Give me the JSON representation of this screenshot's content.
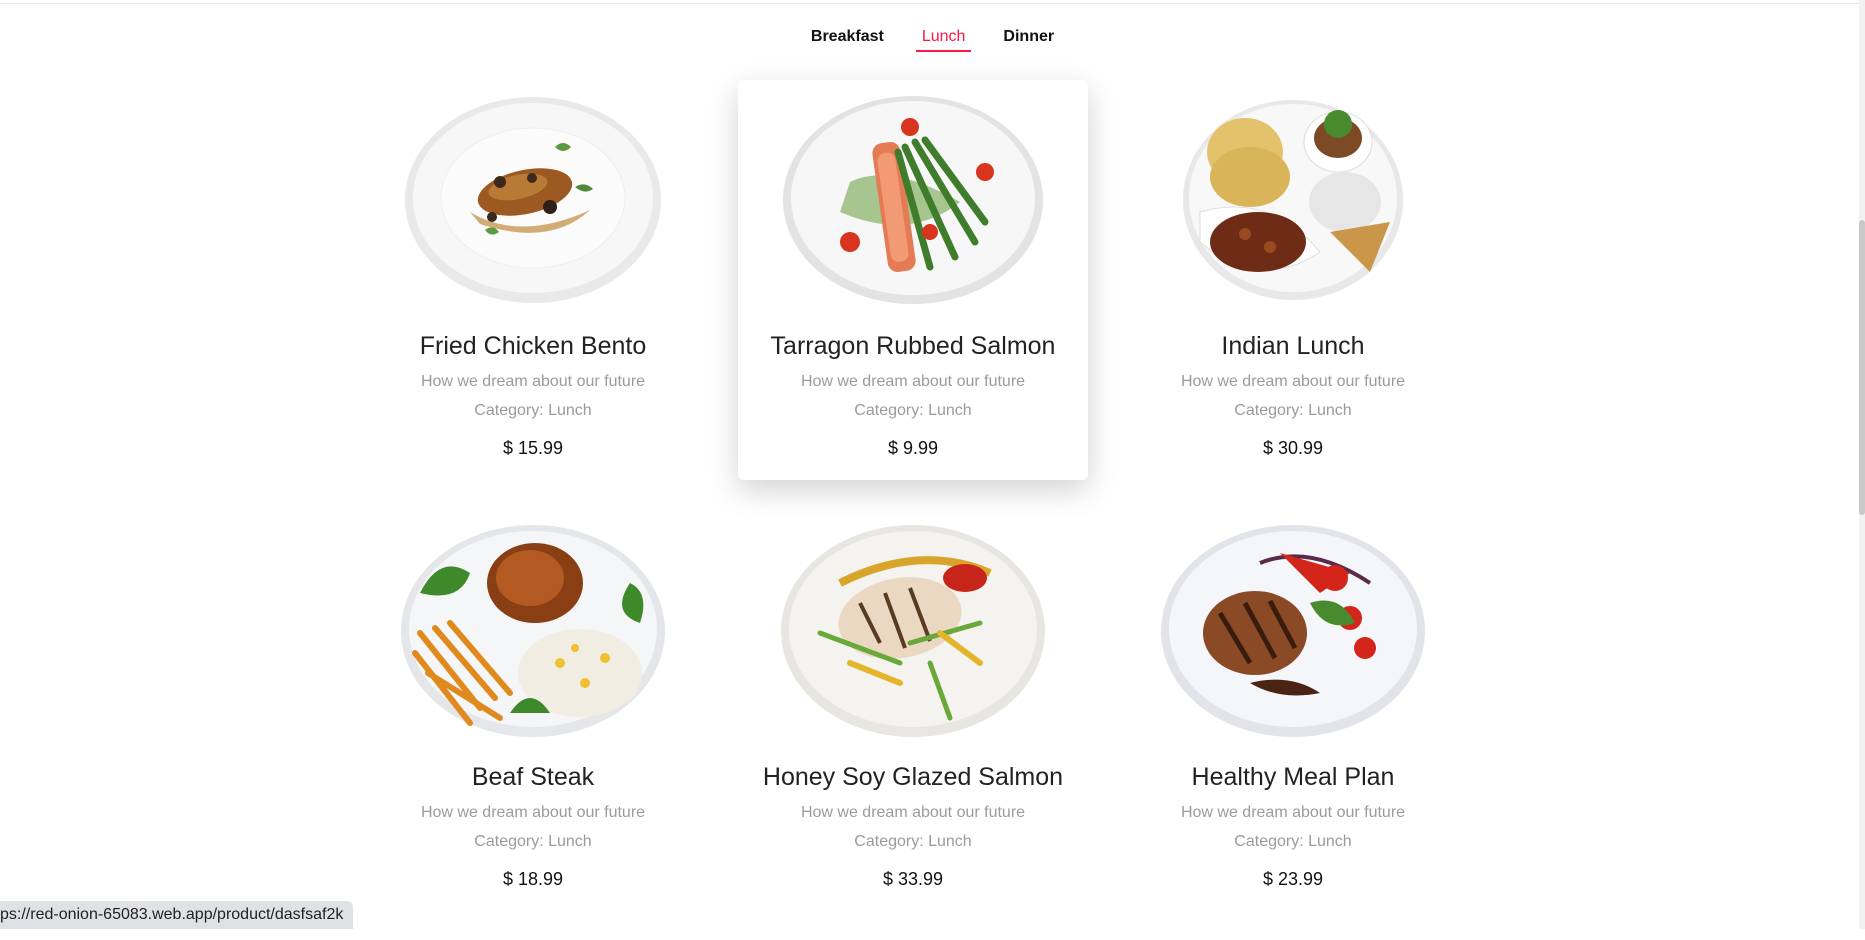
{
  "tabs": [
    {
      "label": "Breakfast",
      "active": false
    },
    {
      "label": "Lunch",
      "active": true
    },
    {
      "label": "Dinner",
      "active": false
    }
  ],
  "items": [
    {
      "title": "Fried Chicken Bento",
      "desc": "How we dream about our future",
      "category": "Category: Lunch",
      "price": "$ 15.99"
    },
    {
      "title": "Tarragon Rubbed Salmon",
      "desc": "How we dream about our future",
      "category": "Category: Lunch",
      "price": "$ 9.99"
    },
    {
      "title": "Indian Lunch",
      "desc": "How we dream about our future",
      "category": "Category: Lunch",
      "price": "$ 30.99"
    },
    {
      "title": "Beaf Steak",
      "desc": "How we dream about our future",
      "category": "Category: Lunch",
      "price": "$ 18.99"
    },
    {
      "title": "Honey Soy Glazed Salmon",
      "desc": "How we dream about our future",
      "category": "Category: Lunch",
      "price": "$ 33.99"
    },
    {
      "title": "Healthy Meal Plan",
      "desc": "How we dream about our future",
      "category": "Category: Lunch",
      "price": "$ 23.99"
    }
  ],
  "status_bar": {
    "url": "ps://red-onion-65083.web.app/product/dasfsaf2k"
  },
  "colors": {
    "accent": "#f91944"
  }
}
